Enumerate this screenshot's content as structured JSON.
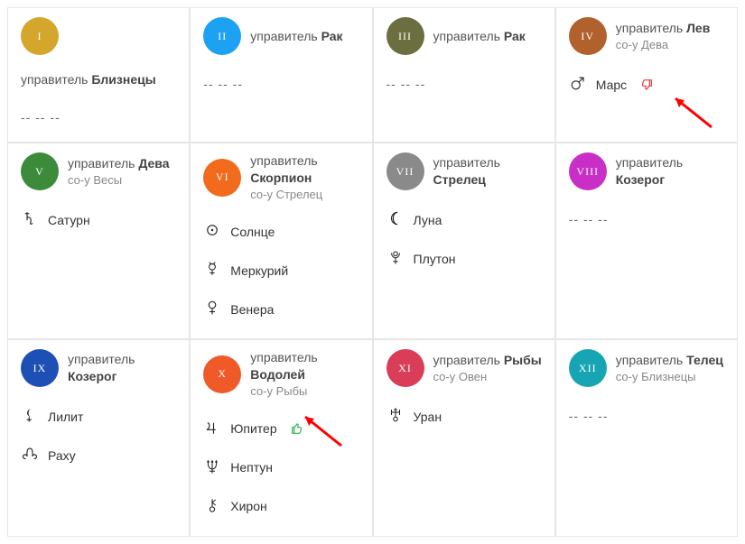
{
  "labels": {
    "ruler_prefix": "управитель",
    "coruler_prefix": "со-у",
    "empty": "-- -- --"
  },
  "houses": [
    {
      "num": "I",
      "color": "#D4A72C",
      "ruler": "Близнецы",
      "coruler": null,
      "ruler_below": true,
      "planets": [],
      "empty": true
    },
    {
      "num": "II",
      "color": "#1DA1F2",
      "ruler": "Рак",
      "coruler": null,
      "ruler_below": false,
      "planets": [],
      "empty": true
    },
    {
      "num": "III",
      "color": "#6B6E3F",
      "ruler": "Рак",
      "coruler": null,
      "ruler_below": false,
      "planets": [],
      "empty": true
    },
    {
      "num": "IV",
      "color": "#B0612C",
      "ruler": "Лев",
      "coruler": "Дева",
      "ruler_below": false,
      "planets": [
        {
          "sym": "mars",
          "name": "Марс",
          "vote": "down"
        }
      ],
      "empty": false
    },
    {
      "num": "V",
      "color": "#3C8B3B",
      "ruler": "Дева",
      "coruler": "Весы",
      "ruler_below": false,
      "planets": [
        {
          "sym": "saturn",
          "name": "Сатурн"
        }
      ],
      "empty": false
    },
    {
      "num": "VI",
      "color": "#F26A1B",
      "ruler": "Скорпион",
      "coruler": "Стрелец",
      "ruler_below": false,
      "planets": [
        {
          "sym": "sun",
          "name": "Солнце"
        },
        {
          "sym": "mercury",
          "name": "Меркурий"
        },
        {
          "sym": "venus",
          "name": "Венера"
        }
      ],
      "empty": false
    },
    {
      "num": "VII",
      "color": "#8A8A8A",
      "ruler": "Стрелец",
      "coruler": null,
      "ruler_below": false,
      "planets": [
        {
          "sym": "moon",
          "name": "Луна"
        },
        {
          "sym": "pluto",
          "name": "Плутон"
        }
      ],
      "empty": false
    },
    {
      "num": "VIII",
      "color": "#C92FC7",
      "ruler": "Козерог",
      "coruler": null,
      "ruler_below": false,
      "planets": [],
      "empty": true
    },
    {
      "num": "IX",
      "color": "#1E4FB5",
      "ruler": "Козерог",
      "coruler": null,
      "ruler_below": false,
      "planets": [
        {
          "sym": "lilith",
          "name": "Лилит"
        },
        {
          "sym": "rahu",
          "name": "Раху"
        }
      ],
      "empty": false
    },
    {
      "num": "X",
      "color": "#F05A28",
      "ruler": "Водолей",
      "coruler": "Рыбы",
      "ruler_below": false,
      "planets": [
        {
          "sym": "jupiter",
          "name": "Юпитер",
          "vote": "up"
        },
        {
          "sym": "neptune",
          "name": "Нептун"
        },
        {
          "sym": "chiron",
          "name": "Хирон"
        }
      ],
      "empty": false
    },
    {
      "num": "XI",
      "color": "#D93D57",
      "ruler": "Рыбы",
      "coruler": "Овен",
      "ruler_below": false,
      "planets": [
        {
          "sym": "uranus",
          "name": "Уран"
        }
      ],
      "empty": false
    },
    {
      "num": "XII",
      "color": "#17A5B3",
      "ruler": "Телец",
      "coruler": "Близнецы",
      "ruler_below": false,
      "planets": [],
      "empty": true
    }
  ],
  "arrows": [
    {
      "house_index": 3,
      "target": "vote"
    },
    {
      "house_index": 9,
      "target": "vote"
    }
  ]
}
